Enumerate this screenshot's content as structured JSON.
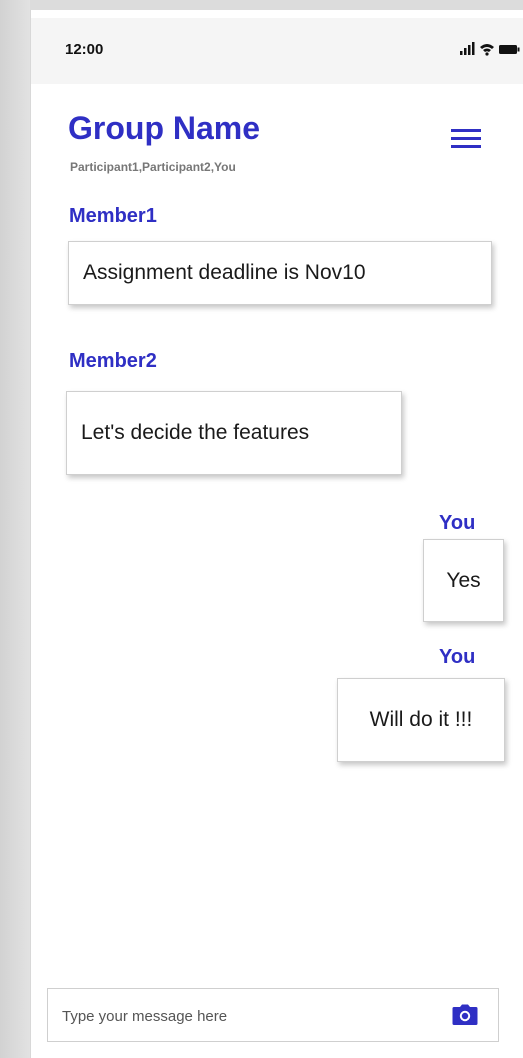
{
  "status_bar": {
    "time": "12:00",
    "icons": [
      "signal-icon",
      "wifi-icon",
      "battery-icon"
    ]
  },
  "header": {
    "title": "Group Name",
    "participants": "Participant1,Participant2,You",
    "menu_icon": "hamburger-menu-icon"
  },
  "messages": [
    {
      "sender": "Member1",
      "text": "Assignment deadline is Nov10",
      "side": "left"
    },
    {
      "sender": "Member2",
      "text": "Let's decide the features",
      "side": "left"
    },
    {
      "sender": "You",
      "text": "Yes",
      "side": "right"
    },
    {
      "sender": "You",
      "text": "Will do it !!!",
      "side": "right"
    }
  ],
  "composer": {
    "placeholder": "Type your message here",
    "value": "",
    "camera_icon": "camera-icon"
  },
  "colors": {
    "accent": "#2f2fc4",
    "subtitle": "#777777",
    "status_bar_bg": "#f5f5f5"
  }
}
